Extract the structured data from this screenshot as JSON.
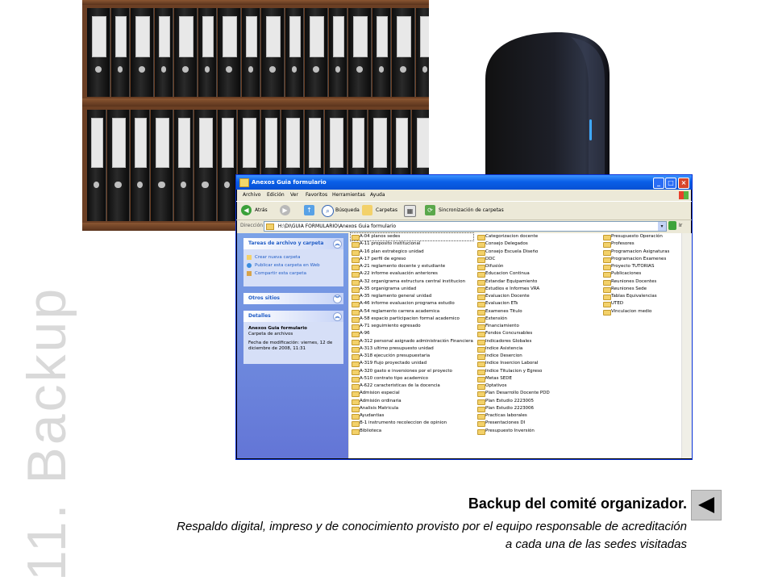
{
  "slide": {
    "vertical_title": "11. Backup",
    "caption_title": "Backup del comité organizador.",
    "caption_line1": "Respaldo digital, impreso y de conocimiento provisto por el equipo responsable de acreditación",
    "caption_line2": "a cada una de las sedes visitadas"
  },
  "explorer": {
    "window_title": "Anexos  Guia formulario",
    "menu": [
      "Archivo",
      "Edición",
      "Ver",
      "Favoritos",
      "Herramientas",
      "Ayuda"
    ],
    "toolbar": {
      "back_label": "Atrás",
      "search_label": "Búsqueda",
      "folders_label": "Carpetas",
      "sync_label": "Sincronización de carpetas"
    },
    "address": {
      "label": "Dirección",
      "value": "H:\\DI\\GUIA FORMULARIO\\Anexos  Guia formulario",
      "go_label": "Ir"
    },
    "task_pane": {
      "tasks_header": "Tareas de archivo y carpeta",
      "tasks": [
        "Crear nueva carpeta",
        "Publicar esta carpeta en Web",
        "Compartir esta carpeta"
      ],
      "other_header": "Otros sitios",
      "details_header": "Detalles",
      "details_name": "Anexos  Guia formulario",
      "details_type": "Carpeta de archivos",
      "details_modified": "Fecha de modificación: viernes, 12 de diciembre de 2008, 11:31"
    },
    "folders_col1": [
      "A-04 planos sedes",
      "A-11 proposito institucional",
      "A-16 plan estrategico unidad",
      "A-17 perfil de egreso",
      "A-21 reglamento docente y estudiante",
      "A-22 informe evaluación anteriores",
      "A-32 organigrama estructura central institucion",
      "A-35 organigrama unidad",
      "A-35 reglamento general unidad",
      "A-46 informe evaluacion programa estudio",
      "A-54 reglamento carrera academica",
      "A-58 espacio participacion formal academico",
      "A-71 seguimiento egresado",
      "A-96",
      "A-312 personal asignado administración Financiera",
      "A-313 ultimo presupuesto unidad",
      "A-318 ejecución presupuestaria",
      "A-319 flujo proyectado unidad",
      "A-320 gasto e inversiones por el proyecto",
      "A-510 contrato tipo academico",
      "A-622 caracteristicas de la docencia",
      "Admision especial",
      "Admisión ordinaria",
      "Analisis Matricula",
      "Ayudantias",
      "B-1 instrumento recoleccion de opinion",
      "Biblioteca"
    ],
    "folders_col2": [
      "Categorizacion docente",
      "Consejo Delegados",
      "Consejo Escuela Diseño",
      "DDC",
      "Difusión",
      "Educacion Continua",
      "Estandar Equipamiento",
      "Estudios e Informes VRA",
      "Evaluacion Docente",
      "Evaluacion ETs",
      "Examenes Titulo",
      "Extensión",
      "Financiamiento",
      "Fondos Concursables",
      "Indicadores Globales",
      "Indice Asistencia",
      "Indice Desercion",
      "Indice Insercion Laboral",
      "Indice Titulacion y Egreso",
      "Metas SEDE",
      "Optativos",
      "Plan Desarrollo Docente PDD",
      "Plan Estudio 2223005",
      "Plan Estudio 2223006",
      "Practicas laborales",
      "Presentaciones DI",
      "Presupuesto Inversión"
    ],
    "folders_col3": [
      "Presupuesto Operación",
      "Profesores",
      "Programacion Asignaturas",
      "Programacion Examenes",
      "Proyecto TUTORIAS",
      "Publicaciones",
      "Reuniones Docentes",
      "Reuniones Sede",
      "Tablas Equivalencias",
      "UTED",
      "Vinculacion medio"
    ]
  },
  "colors": {
    "title_gray": "#d9d9d9",
    "xp_blue": "#0a5fe8",
    "task_pane_blue": "#6375d6",
    "folder_yellow": "#f3d16a"
  }
}
